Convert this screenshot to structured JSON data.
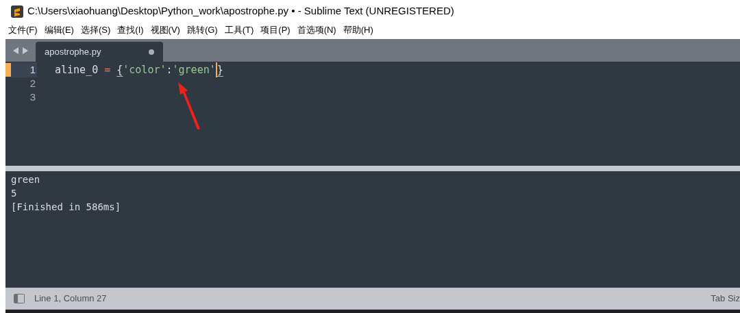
{
  "window": {
    "title": "C:\\Users\\xiaohuang\\Desktop\\Python_work\\apostrophe.py • - Sublime Text (UNREGISTERED)"
  },
  "menu": [
    "文件(F)",
    "编辑(E)",
    "选择(S)",
    "查找(I)",
    "视图(V)",
    "跳转(G)",
    "工具(T)",
    "项目(P)",
    "首选项(N)",
    "帮助(H)"
  ],
  "tabs": [
    {
      "label": "apostrophe.py",
      "selected": true,
      "modified": true
    }
  ],
  "editor": {
    "lines": [
      {
        "number": "1",
        "current": true,
        "tokens": [
          {
            "kind": "ident",
            "text": "aline_0"
          },
          {
            "kind": "operator",
            "text": "="
          },
          {
            "kind": "brace",
            "text": "{"
          },
          {
            "kind": "string",
            "text": "'color'"
          },
          {
            "kind": "punct",
            "text": ":"
          },
          {
            "kind": "string",
            "text": "'green'"
          },
          {
            "kind": "brace",
            "text": "}"
          }
        ]
      },
      {
        "number": "2",
        "current": false
      },
      {
        "number": "3",
        "current": false
      }
    ]
  },
  "output": [
    "green",
    "5",
    "[Finished in 586ms]"
  ],
  "status_bar": {
    "position": "Line 1, Column 27",
    "tab_size": "Tab Siz"
  }
}
